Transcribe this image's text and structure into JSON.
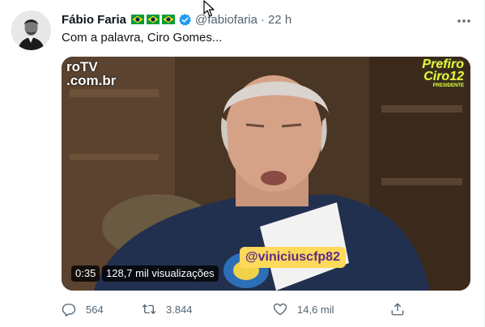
{
  "tweet": {
    "author_name": "Fábio Faria",
    "handle": "@fabiofaria",
    "separator": "·",
    "time": "22 h",
    "text": "Com a palavra, Ciro Gomes..."
  },
  "media": {
    "logo_left_line1": "roTV",
    "logo_left_line2": ".com.br",
    "logo_right_line1": "Prefiro",
    "logo_right_line2": "Ciro12",
    "logo_right_sub": "PRESIDENTE",
    "watermark": "@viniciuscfp82",
    "duration": "0:35",
    "views": "128,7 mil visualizações"
  },
  "actions": {
    "replies": "564",
    "retweets": "3.844",
    "likes": "14,6 mil"
  },
  "icons": [
    "avatar",
    "brazil-flag-icon",
    "verified-icon",
    "more-icon",
    "mouse-cursor-icon",
    "reply-icon",
    "retweet-icon",
    "like-icon",
    "share-icon"
  ],
  "colors": {
    "text": "#0f1419",
    "secondary": "#536471",
    "verified": "#1d9bf0",
    "flag_green": "#009c3b",
    "flag_yellow": "#ffdf00",
    "flag_blue": "#002776"
  }
}
